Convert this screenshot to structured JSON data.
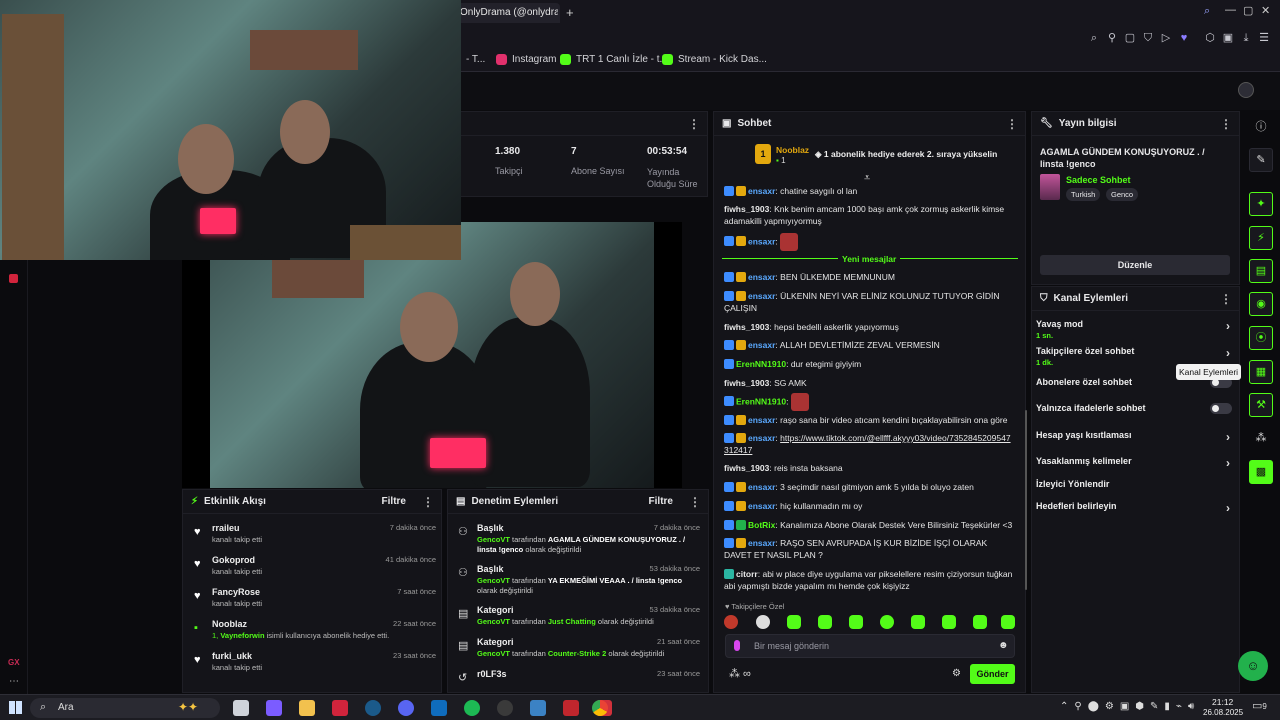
{
  "browser": {
    "tab_title": "OnlyDrama (@onlydrama...",
    "bookmarks": [
      {
        "label": "- T...",
        "color": "#ff3b30"
      },
      {
        "label": "Instagram",
        "color": "#e1306c"
      },
      {
        "label": "TRT 1 Canlı İzle - t...",
        "color": "#53fc18"
      },
      {
        "label": "Stream - Kick Das...",
        "color": "#53fc18"
      }
    ]
  },
  "stats": {
    "followers_value": "1.380",
    "followers_label": "Takipçi",
    "subs_value": "7",
    "subs_label": "Abone Sayısı",
    "uptime_value": "00:53:54",
    "uptime_label": "Yayında Olduğu Süre"
  },
  "chat": {
    "title": "Sohbet",
    "pinned_user": "Nooblaz",
    "pinned_count": "1",
    "pinned_rank": "1",
    "pinned_text": "1 abonelik hediye ederek 2. sıraya yükselin",
    "new_messages_label": "Yeni mesajlar",
    "messages": [
      {
        "user": "ensaxr",
        "color": "u-blue",
        "badges": [
          "b-blue",
          "b-gold"
        ],
        "text": "chatine saygılı ol lan"
      },
      {
        "user": "fiwhs_1903",
        "color": "u-white",
        "badges": [],
        "text": "Knk benim amcam 1000 başı amk çok zormuş askerlik kimse adamakilli yapmıyıyormuş"
      },
      {
        "user": "ensaxr",
        "color": "u-blue",
        "badges": [
          "b-blue",
          "b-gold"
        ],
        "text": "",
        "emote": true
      },
      {
        "user": "ensaxr",
        "color": "u-blue",
        "badges": [
          "b-blue",
          "b-gold"
        ],
        "text": "BEN ÜLKEMDE MEMNUNUM"
      },
      {
        "user": "ensaxr",
        "color": "u-blue",
        "badges": [
          "b-blue",
          "b-gold"
        ],
        "text": "ÜLKENİN NEYİ VAR ELİNİZ KOLUNUZ TUTUYOR GİDİN ÇALIŞIN"
      },
      {
        "user": "fiwhs_1903",
        "color": "u-white",
        "badges": [],
        "text": "hepsi bedelli askerlik yapıyormuş"
      },
      {
        "user": "ensaxr",
        "color": "u-blue",
        "badges": [
          "b-blue",
          "b-gold"
        ],
        "text": "ALLAH DEVLETİMİZE ZEVAL VERMESİN"
      },
      {
        "user": "ErenNN1910",
        "color": "u-green",
        "badges": [
          "b-blue"
        ],
        "text": "dur etegimi giyiyim"
      },
      {
        "user": "fiwhs_1903",
        "color": "u-white",
        "badges": [],
        "text": "SG AMK"
      },
      {
        "user": "ErenNN1910",
        "color": "u-green",
        "badges": [
          "b-blue"
        ],
        "text": "",
        "emote": true
      },
      {
        "user": "ensaxr",
        "color": "u-blue",
        "badges": [
          "b-blue",
          "b-gold"
        ],
        "text": "raşo sana bir video atıcam kendini bıçaklayabilirsin ona göre"
      },
      {
        "user": "ensaxr",
        "color": "u-blue",
        "badges": [
          "b-blue",
          "b-gold"
        ],
        "text": "https://www.tiktok.com/@ellfff.akyyy03/video/7352845209547312417"
      },
      {
        "user": "fiwhs_1903",
        "color": "u-white",
        "badges": [],
        "text": "reis insta baksana"
      },
      {
        "user": "ensaxr",
        "color": "u-blue",
        "badges": [
          "b-blue",
          "b-gold"
        ],
        "text": "3 seçimdir nasıl gitmiyon amk 5 yılda bi oluyo zaten"
      },
      {
        "user": "ensaxr",
        "color": "u-blue",
        "badges": [
          "b-blue",
          "b-gold"
        ],
        "text": "hiç kullanmadın mı oy"
      },
      {
        "user": "BotRix",
        "color": "u-green",
        "badges": [
          "b-blue",
          "b-green"
        ],
        "text": "Kanalımıza Abone Olarak Destek Vere Bilirsiniz Teşekürler <3"
      },
      {
        "user": "ensaxr",
        "color": "u-blue",
        "badges": [
          "b-blue",
          "b-gold"
        ],
        "text": "RAŞO SEN AVRUPADA İŞ KUR BİZİDE İŞÇİ OLARAK DAVET ET NASIL PLAN ?"
      },
      {
        "user": "citorr",
        "color": "u-white",
        "badges": [
          "b-teal"
        ],
        "text": "abi w place diye uygulama var pikselellere resim çiziyorsun tuğkan abi yapmıştı bizde yapalım mı hemde çok kişiyizz"
      }
    ],
    "followers_only_label": "Takipçilere Özel",
    "input_placeholder": "Bir mesaj gönderin",
    "send_label": "Gönder"
  },
  "stream_info": {
    "title": "Yayın bilgisi",
    "stream_title": "AGAMLA GÜNDEM KONUŞUYORUZ . / linsta !genco",
    "category": "Sadece Sohbet",
    "tags": [
      "Turkish",
      "Genco"
    ],
    "edit_label": "Düzenle"
  },
  "channel_actions": {
    "title": "Kanal Eylemleri",
    "tooltip": "Kanal Eylemleri",
    "items": [
      {
        "label": "Yavaş mod",
        "sub": "1 sn.",
        "kind": "chevron"
      },
      {
        "label": "Takipçilere özel sohbet",
        "sub": "1 dk.",
        "kind": "chevron"
      },
      {
        "label": "Abonelere özel sohbet",
        "sub": "",
        "kind": "toggle"
      },
      {
        "label": "Yalnızca ifadelerle sohbet",
        "sub": "",
        "kind": "toggle"
      },
      {
        "label": "Hesap yaşı kısıtlaması",
        "sub": "",
        "kind": "chevron"
      },
      {
        "label": "Yasaklanmış kelimeler",
        "sub": "",
        "kind": "chevron"
      },
      {
        "label": "İzleyici Yönlendir",
        "sub": "",
        "kind": "none"
      },
      {
        "label": "Hedefleri belirleyin",
        "sub": "",
        "kind": "chevron"
      }
    ]
  },
  "activity": {
    "title": "Etkinlik Akışı",
    "filter_label": "Filtre",
    "items": [
      {
        "name": "rraileu",
        "sub": "kanalı takip etti",
        "time": "7 dakika önce",
        "icon": "heart"
      },
      {
        "name": "Gokoprod",
        "sub": "kanalı takip etti",
        "time": "41 dakika önce",
        "icon": "heart"
      },
      {
        "name": "FancyRose",
        "sub": "kanalı takip etti",
        "time": "7 saat önce",
        "icon": "heart"
      },
      {
        "name": "Nooblaz",
        "sub_prefix": "1, ",
        "sub_user": "Vayneforwin",
        "sub": " isimli kullanıcıya abonelik hediye etti.",
        "time": "22 saat önce",
        "icon": "gift"
      },
      {
        "name": "furki_ukk",
        "sub": "kanalı takip etti",
        "time": "23 saat önce",
        "icon": "heart"
      }
    ]
  },
  "moderation": {
    "title": "Denetim Eylemleri",
    "filter_label": "Filtre",
    "items": [
      {
        "title": "Başlık",
        "time": "7 dakika önce",
        "actor": "GencoVT",
        "middle": " tarafından ",
        "value": "AGAMLA GÜNDEM KONUŞUYORUZ . / linsta !genco",
        "suffix": " olarak değiştirildi",
        "icon": "title"
      },
      {
        "title": "Başlık",
        "time": "53 dakika önce",
        "actor": "GencoVT",
        "middle": " tarafından ",
        "value": "YA EKMEĞİMİ VEAAA . / linsta !genco",
        "suffix": " olarak değiştirildi",
        "icon": "title"
      },
      {
        "title": "Kategori",
        "time": "53 dakika önce",
        "actor": "GencoVT",
        "middle": " tarafından ",
        "value": "Just Chatting",
        "suffix": " olarak değiştirildi",
        "icon": "category"
      },
      {
        "title": "Kategori",
        "time": "21 saat önce",
        "actor": "GencoVT",
        "middle": " tarafından ",
        "value": "Counter-Strike 2",
        "suffix": " olarak değiştirildi",
        "icon": "category"
      },
      {
        "title": "r0LF3s",
        "time": "23 saat önce",
        "actor": "",
        "middle": "",
        "value": "",
        "suffix": "",
        "icon": "undo"
      }
    ]
  },
  "taskbar": {
    "search_label": "Ara",
    "time": "21:12",
    "date": "26.08.2025",
    "notif_count": "9",
    "icons": [
      {
        "name": "task-view",
        "color": "#cfd3da"
      },
      {
        "name": "copilot",
        "color": "#7b5cff"
      },
      {
        "name": "files",
        "color": "#f2c14e"
      },
      {
        "name": "opera",
        "color": "#d0243c"
      },
      {
        "name": "steam",
        "color": "#1b5a8a"
      },
      {
        "name": "discord",
        "color": "#5865f2"
      },
      {
        "name": "outlook",
        "color": "#0f6cbd"
      },
      {
        "name": "spotify",
        "color": "#1db954"
      },
      {
        "name": "obs",
        "color": "#3a3a3a"
      },
      {
        "name": "app-blue",
        "color": "#3b82c4"
      },
      {
        "name": "app-red",
        "color": "#c0262d"
      },
      {
        "name": "app-red2",
        "color": "#d1313b"
      },
      {
        "name": "chrome",
        "color": "#e3a21a"
      }
    ]
  },
  "colors": {
    "accent": "#53fc18",
    "bg": "#0b0b0e",
    "panel": "#141419"
  }
}
